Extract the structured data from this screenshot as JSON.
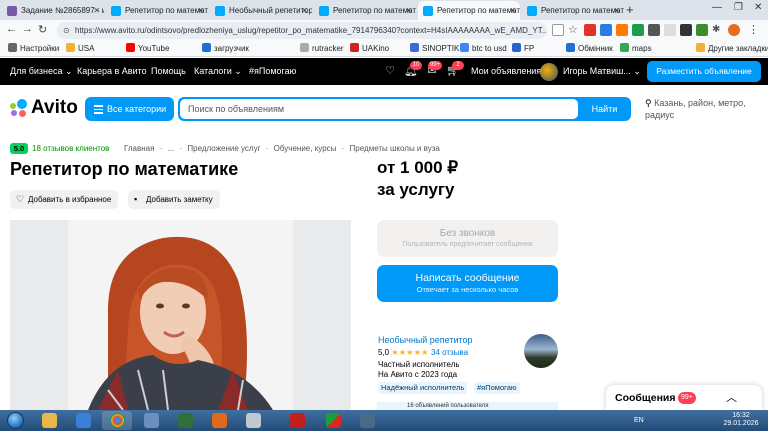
{
  "browser": {
    "tabs": [
      {
        "label": "Задание №2865897 - и",
        "icon_color": "#7a5aa8",
        "active": false
      },
      {
        "label": "Репетитор по математ",
        "icon_color": "#00aaff",
        "active": false
      },
      {
        "label": "Необычный репетитор",
        "icon_color": "#00aaff",
        "active": false
      },
      {
        "label": "Репетитор по математ",
        "icon_color": "#00aaff",
        "active": false
      },
      {
        "label": "Репетитор по математ",
        "icon_color": "#00aaff",
        "active": true
      },
      {
        "label": "Репетитор по математ",
        "icon_color": "#00aaff",
        "active": false
      }
    ],
    "url": "https://www.avito.ru/odintsovo/predlozheniya_uslug/repetitor_po_matematike_7914796340?context=H4sIAAAAAAAA_wE_AMD_YT...",
    "bookmarks": [
      "Настройки",
      "USA",
      "YouTube",
      "загрузчик",
      "rutracker",
      "UAKino",
      "SINOPTIK",
      "btc to usd",
      "FP",
      "Обмінник",
      "maps"
    ],
    "other_bookmarks": "Другие закладки"
  },
  "avito": {
    "topnav": {
      "for_business": "Для бизнеса",
      "career": "Карьера в Авито",
      "help": "Помощь",
      "catalogs": "Каталоги",
      "i_help": "#яПомогаю",
      "notif_badge": "10",
      "messages_badge": "99+",
      "cart_badge": "2",
      "my_ads": "Мои объявления",
      "user_name": "Игорь Матвиш...",
      "post_ad": "Разместить объявление"
    },
    "logo": "Avito",
    "categories_button": "Все категории",
    "search": {
      "placeholder": "Поиск по объявлениям",
      "button": "Найти"
    },
    "location": "Казань, район, метро, радиус"
  },
  "listing": {
    "rating": "5.0",
    "reviews": "18 отзывов клиентов",
    "breadcrumb": [
      "Главная",
      "·",
      "...",
      "·",
      "Предложение услуг",
      "·",
      "Обучение, курсы",
      "·",
      "Предметы школы и вуза"
    ],
    "title": "Репетитор по математике",
    "add_favorite": "Добавить в избранное",
    "add_note": "Добавить заметку",
    "price_line1": "от 1 000 ₽",
    "price_line2": "за услугу",
    "no_calls": {
      "title": "Без звонков",
      "subtitle": "Пользователь предпочитает сообщения"
    },
    "write_message": {
      "title": "Написать сообщение",
      "subtitle": "Отвечает за несколько часов"
    }
  },
  "seller": {
    "name": "Необычный репетитор",
    "rating": "5,0",
    "stars": "★★★★★",
    "reviews": "34 отзыва",
    "type": "Частный исполнитель",
    "since": "На Авито с 2023 года",
    "tags": [
      "Надёжный исполнитель",
      "#яПомогаю"
    ],
    "partial_text": "16 объявлений пользователя"
  },
  "messages_widget": {
    "label": "Сообщения",
    "badge": "99+"
  },
  "taskbar": {
    "lang": "EN",
    "time": "16:32",
    "date": "29.01.2026"
  }
}
